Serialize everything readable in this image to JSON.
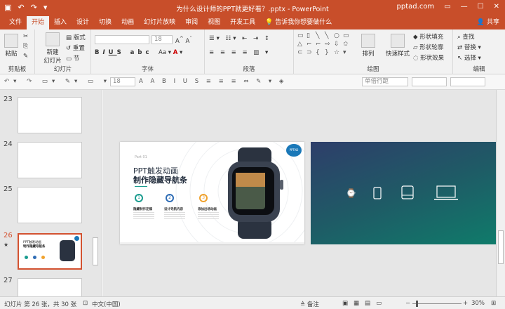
{
  "window": {
    "title": "为什么设计师的PPT就更好看？.pptx  -  PowerPoint",
    "account": "pptad.com"
  },
  "tabs": [
    "文件",
    "开始",
    "插入",
    "设计",
    "切换",
    "动画",
    "幻灯片放映",
    "审阅",
    "视图",
    "开发工具"
  ],
  "active_tab": "开始",
  "tell_me": "告诉我你想要做什么",
  "share": "共享",
  "ribbon": {
    "clipboard": {
      "label": "剪贴板",
      "paste": "粘贴"
    },
    "slides": {
      "label": "幻灯片",
      "new_slide": "新建",
      "new_slide2": "幻灯片",
      "layout": "版式",
      "reset": "重置",
      "section": "节"
    },
    "font": {
      "label": "字体",
      "size": "18"
    },
    "paragraph": {
      "label": "段落"
    },
    "drawing": {
      "label": "绘图",
      "arrange": "排列",
      "quick_styles": "快速样式",
      "fill": "形状填充",
      "outline": "形状轮廓",
      "effects": "形状效果"
    },
    "editing": {
      "label": "编辑",
      "find": "查找",
      "replace": "替换",
      "select": "选择"
    }
  },
  "format_bar": {
    "font_size": "18",
    "spacing": "单倍行距"
  },
  "thumbnails": [
    {
      "num": "23"
    },
    {
      "num": "24"
    },
    {
      "num": "25"
    },
    {
      "num": "26",
      "mark": "★",
      "title": "PPT触发动画",
      "subtitle": "制作隐藏导航条"
    },
    {
      "num": "27"
    }
  ],
  "slide": {
    "tag": "Part 01",
    "title1": "PPT触发动画",
    "title2": "制作隐藏导航条",
    "logo": "PPTAD",
    "steps": [
      {
        "n": "1",
        "label": "隐藏制作定稿",
        "color": "#1a9c8f"
      },
      {
        "n": "2",
        "label": "设计导航内容",
        "color": "#2f6db5"
      },
      {
        "n": "3",
        "label": "添加出场动画",
        "color": "#f0a22e"
      }
    ]
  },
  "status": {
    "slide_info": "幻灯片 第 26 张，共 30 张",
    "language": "中文(中国)",
    "notes": "备注",
    "zoom": "30%"
  }
}
